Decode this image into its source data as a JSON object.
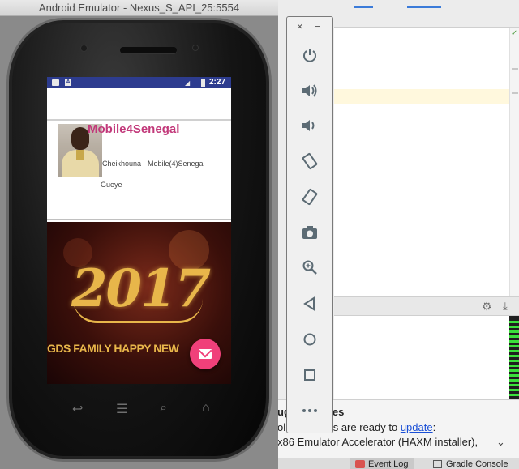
{
  "emulator": {
    "window_title": "Android Emulator - Nexus_S_API_25:5554"
  },
  "status_bar": {
    "time": "2:27",
    "notification_icons": [
      "image-notification-icon",
      "a-notification-icon"
    ],
    "notif_letter": "A"
  },
  "profile_card": {
    "title": "Mobile4Senegal",
    "first_name": "Cheikhouna",
    "company": "Mobile(4)Senegal",
    "last_name": "Gueye"
  },
  "banner": {
    "year": "2017",
    "message": "GDS FAMILY HAPPY NEW"
  },
  "phone_nav": [
    "back-icon",
    "menu-icon",
    "search-icon",
    "home-icon"
  ],
  "toolbar": {
    "close_glyph": "×",
    "minimize_glyph": "−",
    "items": [
      "power-icon",
      "volume-up-icon",
      "volume-down-icon",
      "rotate-left-icon",
      "rotate-right-icon",
      "camera-icon",
      "zoom-icon",
      "back-icon",
      "home-icon",
      "overview-icon",
      "more-icon"
    ]
  },
  "notification": {
    "title": "ugin Updates",
    "line1_prefix": "ol",
    "line1_text": "mponents are ready to ",
    "line1_link": "update",
    "line1_suffix": ":",
    "line2": "x86 Emulator Accelerator (HAXM installer),",
    "expand_glyph": "⌄"
  },
  "status_tabs": {
    "event_log": "Event Log",
    "gradle_console": "Gradle Console"
  },
  "colors": {
    "android_status_bar": "#2d3c8f",
    "card_title": "#c2397a",
    "fab": "#f0407a",
    "banner_gold": "#e8b64a",
    "link": "#1a4fd6"
  }
}
